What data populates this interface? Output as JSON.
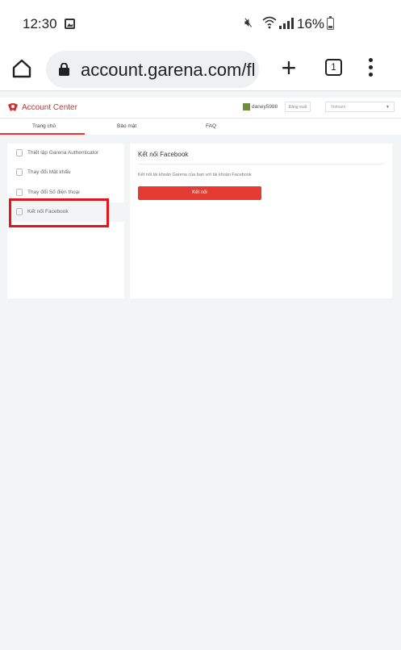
{
  "status_bar": {
    "time": "12:30",
    "battery": "16%"
  },
  "browser": {
    "url": "account.garena.com/fl",
    "tab_count": "1"
  },
  "site": {
    "brand": "Account Center",
    "username": "daney5988",
    "logout_label": "Đăng xuất",
    "language": "Vietnam",
    "nav": [
      "Trang chủ",
      "Bảo mật",
      "FAQ"
    ]
  },
  "sidebar": {
    "items": [
      {
        "label": "Thiết lập Garena Authenticator",
        "icon": "shield-icon"
      },
      {
        "label": "Thay đổi Mật khẩu",
        "icon": "lock-icon"
      },
      {
        "label": "Thay đổi Số điện thoại",
        "icon": "phone-icon"
      },
      {
        "label": "Kết nối Facebook",
        "icon": "facebook-icon"
      }
    ]
  },
  "main": {
    "title": "Kết nối Facebook",
    "description": "Kết nối tài khoản Garena của bạn với tài khoản Facebook",
    "button_label": "Kết nối"
  },
  "colors": {
    "accent": "#e33a32",
    "highlight": "#e4151f",
    "brand": "#d0312d"
  }
}
